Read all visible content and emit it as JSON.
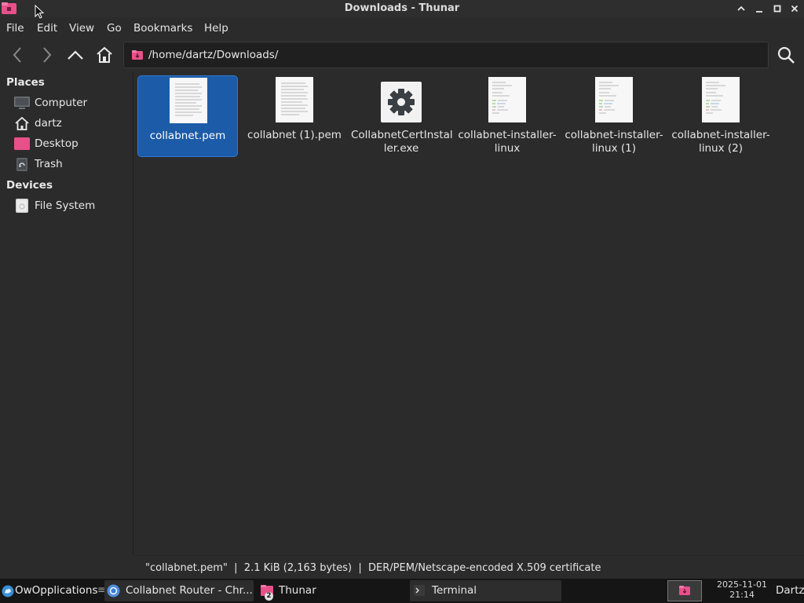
{
  "window": {
    "title": "Downloads - Thunar",
    "controls": [
      "chevron-up-icon",
      "minimize-icon",
      "maximize-icon",
      "close-icon"
    ]
  },
  "menu": {
    "items": [
      "File",
      "Edit",
      "View",
      "Go",
      "Bookmarks",
      "Help"
    ]
  },
  "toolbar": {
    "path": "/home/dartz/Downloads/"
  },
  "sidebar": {
    "places_header": "Places",
    "places": [
      {
        "label": "Computer",
        "icon": "computer-icon"
      },
      {
        "label": "dartz",
        "icon": "home-icon"
      },
      {
        "label": "Desktop",
        "icon": "desktop-folder-icon"
      },
      {
        "label": "Trash",
        "icon": "trash-icon"
      }
    ],
    "devices_header": "Devices",
    "devices": [
      {
        "label": "File System",
        "icon": "drive-icon"
      }
    ]
  },
  "files": [
    {
      "name": "collabnet.pem",
      "selected": true,
      "icon": "text-document-icon"
    },
    {
      "name": "collabnet (1).pem",
      "selected": false,
      "icon": "text-document-icon"
    },
    {
      "name": "CollabnetCertInstaller.exe",
      "name_lines": [
        "CollabnetCertInstal",
        "ler.exe"
      ],
      "selected": false,
      "icon": "executable-gear-icon"
    },
    {
      "name": "collabnet-installer-linux",
      "name_lines": [
        "collabnet-installer-",
        "linux"
      ],
      "selected": false,
      "icon": "script-document-icon"
    },
    {
      "name": "collabnet-installer-linux (1)",
      "name_lines": [
        "collabnet-installer-",
        "linux (1)"
      ],
      "selected": false,
      "icon": "script-document-icon"
    },
    {
      "name": "collabnet-installer-linux (2)",
      "name_lines": [
        "collabnet-installer-",
        "linux (2)"
      ],
      "selected": false,
      "icon": "script-document-icon"
    }
  ],
  "status": {
    "text": "\"collabnet.pem\"  |  2.1 KiB (2,163 bytes)  |  DER/PEM/Netscape-encoded X.509 certificate"
  },
  "taskbar": {
    "apps_label": "OwOpplications",
    "tasks": [
      {
        "label": "Collabnet Router - Chr...",
        "icon": "chrome-icon"
      },
      {
        "label": "Thunar",
        "icon": "thunar-folder-icon",
        "badge": "2"
      },
      {
        "label": "Terminal",
        "icon": "terminal-icon"
      }
    ],
    "clock_date": "2025-11-01",
    "clock_time": "21:14",
    "user": "Dartz"
  },
  "colors": {
    "selection": "#1c5ba8",
    "folder_pink": "#e8508a",
    "background": "#2b2b2b"
  }
}
